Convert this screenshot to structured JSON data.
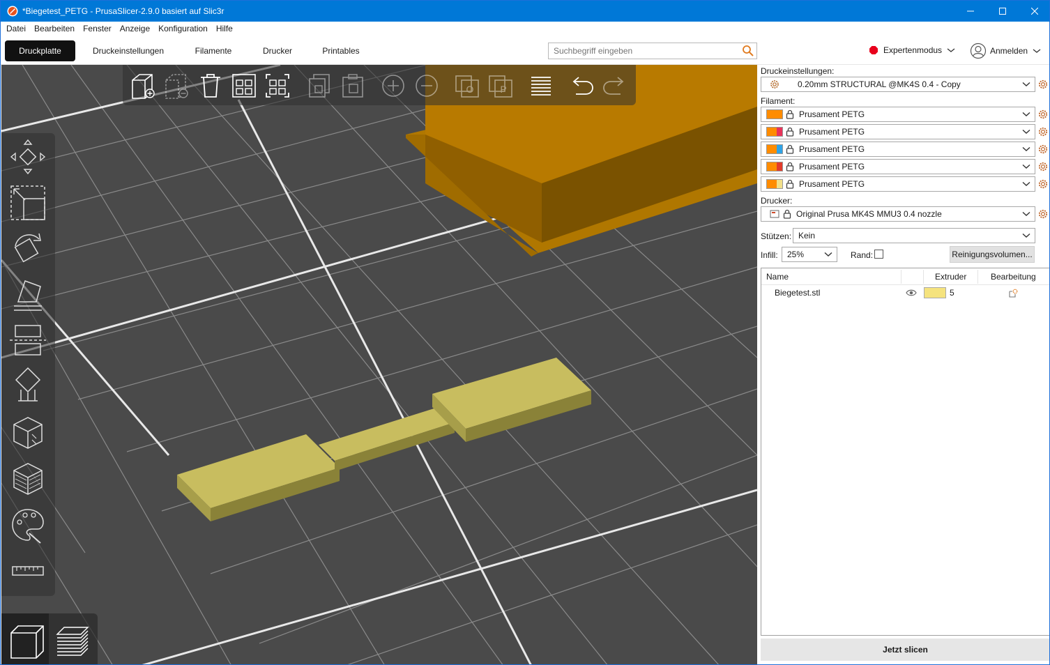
{
  "window": {
    "title": "*Biegetest_PETG - PrusaSlicer-2.9.0 basiert auf Slic3r"
  },
  "menu": [
    "Datei",
    "Bearbeiten",
    "Fenster",
    "Anzeige",
    "Konfiguration",
    "Hilfe"
  ],
  "tabs": [
    {
      "label": "Druckplatte",
      "active": true
    },
    {
      "label": "Druckeinstellungen",
      "active": false
    },
    {
      "label": "Filamente",
      "active": false
    },
    {
      "label": "Drucker",
      "active": false
    },
    {
      "label": "Printables",
      "active": false
    }
  ],
  "search": {
    "placeholder": "Suchbegriff eingeben"
  },
  "header": {
    "mode_label": "Expertenmodus",
    "login_label": "Anmelden"
  },
  "colors": {
    "accent_mode": "#e8001c",
    "model_yellow": "#c8c06a",
    "other_object_orange": "#b07700",
    "title_bar": "#0078d7"
  },
  "toolbar_icons": [
    "add-object-icon",
    "delete-icon",
    "delete-all-icon",
    "arrange-icon",
    "arrange-selection-icon",
    "copy-icon",
    "paste-icon",
    "add-instance-icon",
    "remove-instance-icon",
    "split-to-objects-icon",
    "split-to-parts-icon",
    "variable-layer-height-icon",
    "undo-icon",
    "redo-icon"
  ],
  "side_tools": [
    "move-icon",
    "scale-icon",
    "rotate-icon",
    "place-on-face-icon",
    "cut-icon",
    "support-painting-icon",
    "seam-painting-icon",
    "fuzzy-skin-icon",
    "multimaterial-painting-icon",
    "measure-icon"
  ],
  "panel": {
    "print_settings_label": "Druckeinstellungen:",
    "print_profile": "0.20mm STRUCTURAL @MK4S 0.4 - Copy",
    "filament_label": "Filament:",
    "filaments": [
      {
        "name": "Prusament PETG",
        "color": "#ff8c00",
        "secondary": "#ff8c00"
      },
      {
        "name": "Prusament PETG",
        "color": "#ff8c00",
        "secondary": "#e8335a"
      },
      {
        "name": "Prusament PETG",
        "color": "#ff8c00",
        "secondary": "#2fa3e6"
      },
      {
        "name": "Prusament PETG",
        "color": "#ff8c00",
        "secondary": "#e23b2b"
      },
      {
        "name": "Prusament PETG",
        "color": "#ff8c00",
        "secondary": "#f2e08a"
      }
    ],
    "printer_label": "Drucker:",
    "printer": "Original Prusa MK4S MMU3 0.4 nozzle",
    "supports_label": "Stützen:",
    "supports_value": "Kein",
    "infill_label": "Infill:",
    "infill_value": "25%",
    "brim_label": "Rand:",
    "brim_checked": false,
    "purge_button": "Reinigungsvolumen...",
    "object_list": {
      "columns": [
        "Name",
        "Extruder",
        "Bearbeitung"
      ],
      "rows": [
        {
          "name": "Biegetest.stl",
          "extruder": "5",
          "extruder_color": "#f5e37e"
        }
      ]
    },
    "slice_button": "Jetzt slicen"
  }
}
